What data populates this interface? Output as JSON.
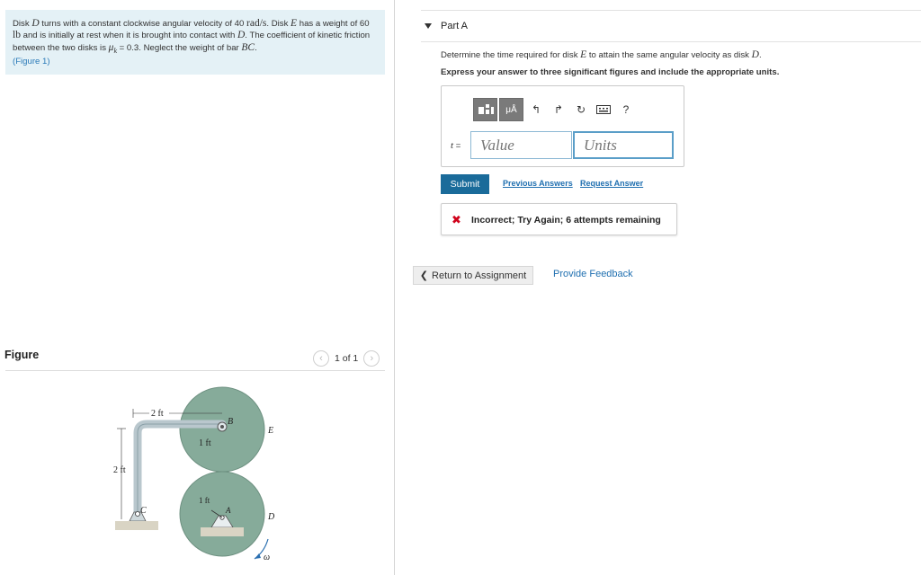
{
  "problem": {
    "s1": "Disk ",
    "d1": "D",
    "s2": " turns with a constant clockwise angular velocity of 40 ",
    "unit_rad": "rad/s",
    "s3": ". Disk ",
    "e1": "E",
    "s4": " has a weight of 60 ",
    "unit_lb": "lb",
    "s5": " and is initially at rest when it is brought into contact with ",
    "d2": "D",
    "s6": ". The coefficient of kinetic friction between the two disks is ",
    "mu": "μ",
    "mu_sub": "k",
    "s7": " = 0.3. Neglect the weight of bar ",
    "bc": "BC",
    "s8": ".",
    "figure_link": "(Figure 1)"
  },
  "figure_panel": {
    "title": "Figure",
    "page": "1 of 1",
    "prev_icon": "chevron-left-icon",
    "next_icon": "chevron-right-icon"
  },
  "diagram": {
    "dim_top": "2 ft",
    "dim_left": "2 ft",
    "dim_bar": "1 ft",
    "dim_low": "1 ft",
    "label_b": "B",
    "label_c": "C",
    "label_e": "E",
    "label_a": "A",
    "label_d": "D",
    "label_omega": "ω"
  },
  "part": {
    "label": "Part A",
    "question_pre": "Determine the time required for disk ",
    "question_e": "E",
    "question_mid": " to attain the same angular velocity as disk ",
    "question_d": "D",
    "question_end": ".",
    "instructions": "Express your answer to three significant figures and include the appropriate units."
  },
  "answer": {
    "var_label": "t",
    "equals": " =",
    "value_placeholder": "Value",
    "units_placeholder": "Units",
    "toolbar": {
      "templates_icon": "templates-icon",
      "mu_label": "μÅ",
      "undo_icon": "undo-icon",
      "redo_icon": "redo-icon",
      "reset_icon": "reset-icon",
      "keyboard_icon": "keyboard-icon",
      "help_label": "?"
    }
  },
  "actions": {
    "submit": "Submit",
    "previous_answers": "Previous Answers",
    "request_answer": "Request Answer"
  },
  "feedback": {
    "icon": "x-icon",
    "text": "Incorrect; Try Again; 6 attempts remaining"
  },
  "footer": {
    "return": "Return to Assignment",
    "provide_feedback": "Provide Feedback"
  },
  "colors": {
    "problem_bg": "#e4f1f6",
    "accent": "#1a6b9a",
    "error": "#d0021b",
    "disk": "#86ab9a"
  }
}
